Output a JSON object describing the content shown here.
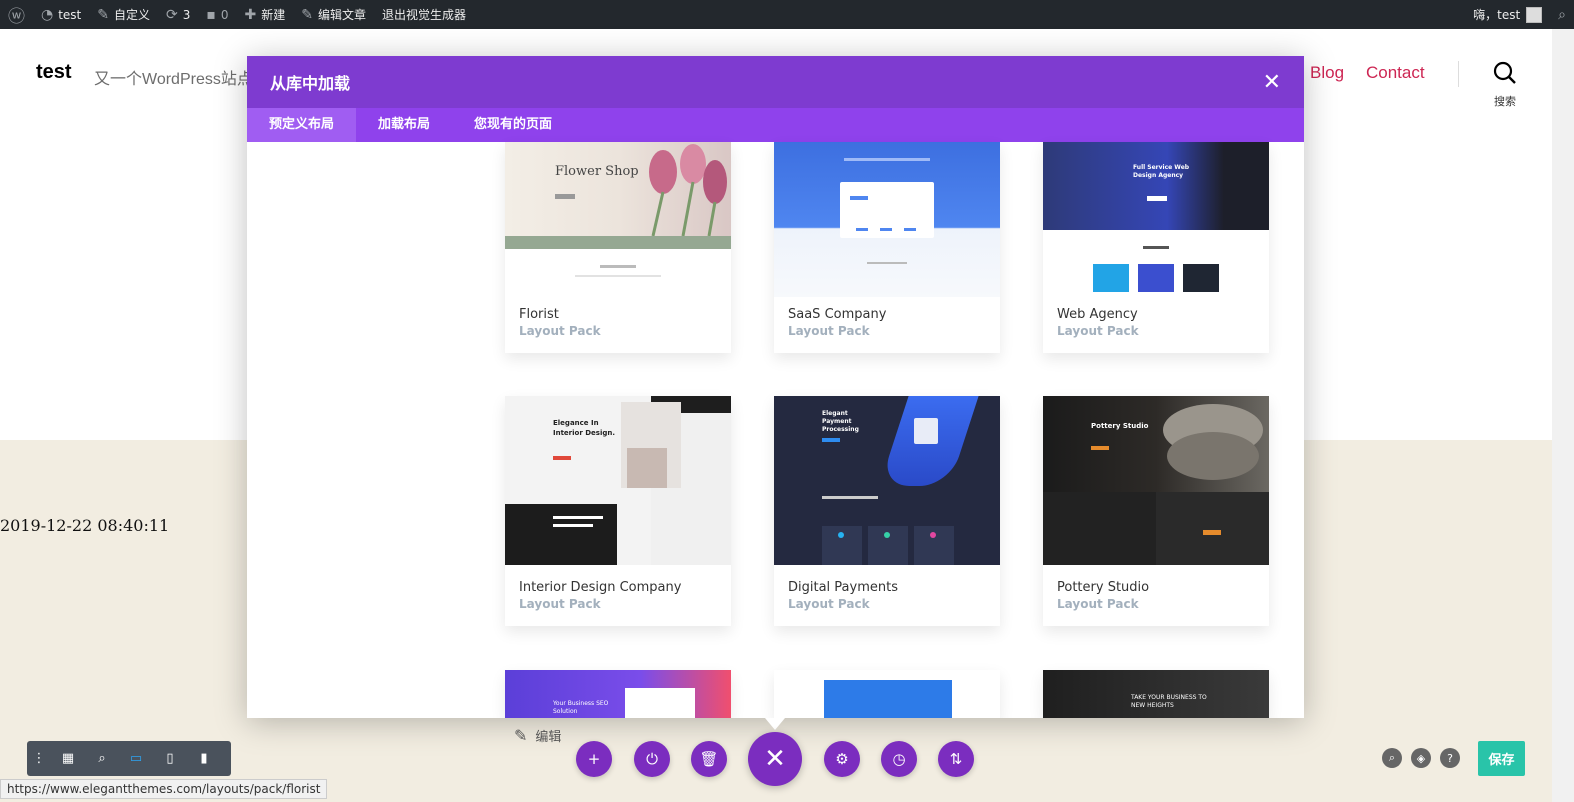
{
  "adminbar": {
    "site_name": "test",
    "customize": "自定义",
    "updates_count": "3",
    "comments_count": "0",
    "new_label": "新建",
    "edit_post": "编辑文章",
    "exit_builder": "退出视觉生成器",
    "greeting": "嗨，test"
  },
  "site": {
    "title": "test",
    "tagline": "又一个WordPress站点",
    "nav": [
      "Blog",
      "Contact"
    ],
    "search_label": "搜索"
  },
  "post": {
    "date": "2019-12-22 08:40:11"
  },
  "modal": {
    "title": "从库中加载",
    "tabs": [
      "预定义布局",
      "加载布局",
      "您现有的页面"
    ],
    "active_tab": "预定义布局",
    "cards": [
      {
        "title": "Florist",
        "subtitle": "Layout Pack",
        "thumb_heading": "Flower Shop"
      },
      {
        "title": "SaaS Company",
        "subtitle": "Layout Pack"
      },
      {
        "title": "Web Agency",
        "subtitle": "Layout Pack",
        "thumb_heading": "Full Service Web Design Agency"
      },
      {
        "title": "Interior Design Company",
        "subtitle": "Layout Pack",
        "thumb_heading": "Elegance In Interior Design."
      },
      {
        "title": "Digital Payments",
        "subtitle": "Layout Pack",
        "thumb_heading": "Elegant Payment Processing"
      },
      {
        "title": "Pottery Studio",
        "subtitle": "Layout Pack",
        "thumb_heading": "Pottery Studio"
      }
    ],
    "partial_row_texts": [
      "Your Business SEO Solution",
      "TAKE YOUR BUSINESS TO NEW HEIGHTS"
    ]
  },
  "builder": {
    "edit_label": "编辑",
    "save_label": "保存",
    "help_label": "?"
  },
  "statusbar": {
    "url": "https://www.elegantthemes.com/layouts/pack/florist"
  },
  "colors": {
    "modal_header": "#7e3bd0",
    "modal_tabs": "#8f42ec",
    "nav_link": "#cd2653",
    "builder_purple": "#7b2dbf",
    "save_green": "#29c4a9"
  }
}
